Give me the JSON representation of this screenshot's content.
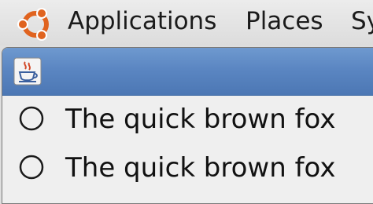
{
  "panel": {
    "menu": [
      {
        "label": "Applications"
      },
      {
        "label": "Places"
      },
      {
        "label": "Sy"
      }
    ]
  },
  "icons": {
    "panel_logo": "ubuntu-logo-icon",
    "window_icon": "java-cup-icon",
    "radio": "radio-button-unchecked-icon"
  },
  "colors": {
    "titlebar": "#5b86c2",
    "panel": "#e4e4e4",
    "content": "#efefef",
    "logo_orange": "#e0631f"
  },
  "window": {
    "options": [
      {
        "label": "The quick brown fox",
        "checked": false
      },
      {
        "label": "The quick brown fox",
        "checked": false
      }
    ]
  }
}
